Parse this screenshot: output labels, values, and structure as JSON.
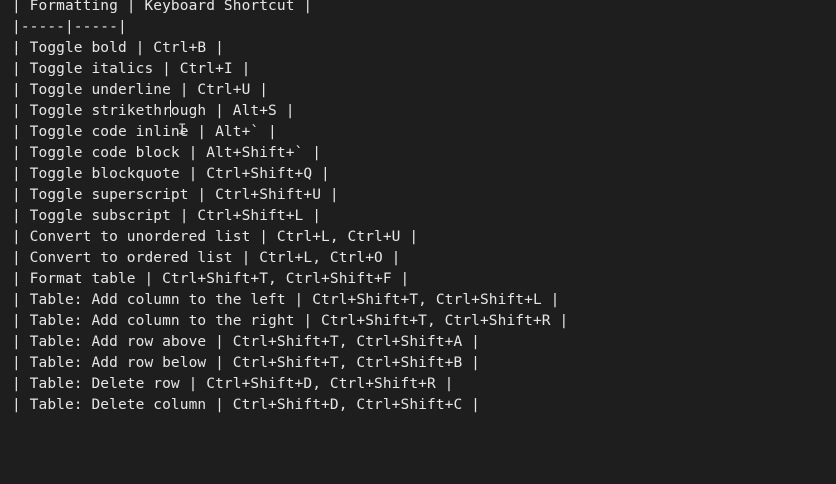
{
  "editor": {
    "lines": [
      "| Formatting | Keyboard Shortcut |",
      "|-----|-----|",
      "| Toggle bold | Ctrl+B |",
      "| Toggle italics | Ctrl+I |",
      "| Toggle underline | Ctrl+U |",
      "| Toggle strikethrough | Alt+S |",
      "| Toggle code inline | Alt+` |",
      "| Toggle code block | Alt+Shift+` |",
      "| Toggle blockquote | Ctrl+Shift+Q |",
      "| Toggle superscript | Ctrl+Shift+U |",
      "| Toggle subscript | Ctrl+Shift+L |",
      "| Convert to unordered list | Ctrl+L, Ctrl+U |",
      "| Convert to ordered list | Ctrl+L, Ctrl+O |",
      "| Format table | Ctrl+Shift+T, Ctrl+Shift+F |",
      "| Table: Add column to the left | Ctrl+Shift+T, Ctrl+Shift+L |",
      "| Table: Add column to the right | Ctrl+Shift+T, Ctrl+Shift+R |",
      "| Table: Add row above | Ctrl+Shift+T, Ctrl+Shift+A |",
      "| Table: Add row below | Ctrl+Shift+T, Ctrl+Shift+B |",
      "| Table: Delete row | Ctrl+Shift+D, Ctrl+Shift+R |",
      "| Table: Delete column | Ctrl+Shift+D, Ctrl+Shift+C |"
    ]
  },
  "cursor": {
    "ibeam_glyph": "I"
  }
}
